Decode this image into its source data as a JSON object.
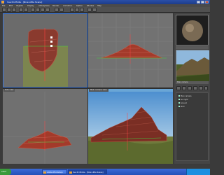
{
  "window": {
    "title": "Vue 6 Infinite - [Nice Little Scene]"
  },
  "menu": {
    "items": [
      "File",
      "Edit",
      "Objects",
      "Display",
      "Atmosphere",
      "Render",
      "Animation",
      "Python",
      "Window",
      "Help"
    ]
  },
  "viewports": {
    "front_label": "Front view",
    "top_label": "Top view",
    "left_label": "Side view",
    "perspective_label": "Main camera view"
  },
  "right_panel": {
    "material_caption": "",
    "preview_caption": "Main camera",
    "tree": [
      "Main camera",
      "Sun light",
      "Ground",
      "Rock"
    ]
  },
  "taskbar": {
    "start_label": "start",
    "tasks": [
      "Adobe Photoshop",
      "Vue 6 Infinite - [Nice Little Scene]"
    ],
    "clock": ""
  },
  "colors": {
    "selection_border": "#3a74d6",
    "terrain": "#a33a2a",
    "sky": "#6aa6d6",
    "ground": "#7f8a4a"
  }
}
